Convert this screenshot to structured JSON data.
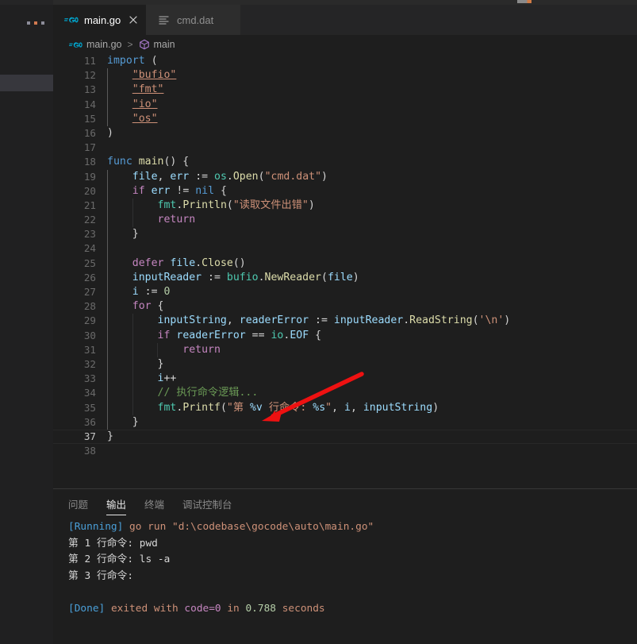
{
  "window": {
    "theme": "dark",
    "colors": {
      "editor_bg": "#1e1e1e",
      "tabbar_bg": "#252526",
      "sidebar_bg": "#202021",
      "accent_keyword": "#569cd6",
      "accent_string": "#ce9178",
      "accent_function": "#dcdcaa",
      "accent_comment": "#6a9955",
      "annotation_arrow": "#ee1111"
    }
  },
  "sidebar": {
    "overflow_label": "...",
    "overflow_icon": "ellipsis-icon"
  },
  "tabs": [
    {
      "label": "main.go",
      "icon": "go-file-icon",
      "active": true,
      "close_icon": "close-icon"
    },
    {
      "label": "cmd.dat",
      "icon": "data-file-icon",
      "active": false
    }
  ],
  "breadcrumb": {
    "items": [
      {
        "label": "main.go",
        "icon": "go-file-icon"
      },
      {
        "label": "main",
        "icon": "symbol-method-cube-icon"
      }
    ],
    "separator": ">"
  },
  "editor": {
    "first_line": 11,
    "active_line": 37,
    "lines": [
      {
        "n": 11,
        "tokens": [
          {
            "t": "import",
            "c": "kw"
          },
          {
            "t": " ",
            "c": "pn"
          },
          {
            "t": "(",
            "c": "pn"
          }
        ]
      },
      {
        "n": 12,
        "tokens": [
          {
            "t": "    ",
            "c": "pn"
          },
          {
            "t": "\"bufio\"",
            "c": "str uline"
          }
        ]
      },
      {
        "n": 13,
        "tokens": [
          {
            "t": "    ",
            "c": "pn"
          },
          {
            "t": "\"fmt\"",
            "c": "str uline"
          }
        ]
      },
      {
        "n": 14,
        "tokens": [
          {
            "t": "    ",
            "c": "pn"
          },
          {
            "t": "\"io\"",
            "c": "str uline"
          }
        ]
      },
      {
        "n": 15,
        "tokens": [
          {
            "t": "    ",
            "c": "pn"
          },
          {
            "t": "\"os\"",
            "c": "str uline"
          }
        ]
      },
      {
        "n": 16,
        "tokens": [
          {
            "t": ")",
            "c": "pn"
          }
        ]
      },
      {
        "n": 17,
        "tokens": []
      },
      {
        "n": 18,
        "tokens": [
          {
            "t": "func ",
            "c": "kw"
          },
          {
            "t": "main",
            "c": "fn"
          },
          {
            "t": "() {",
            "c": "pn"
          }
        ]
      },
      {
        "n": 19,
        "tokens": [
          {
            "t": "    ",
            "c": "pn"
          },
          {
            "t": "file",
            "c": "var"
          },
          {
            "t": ", ",
            "c": "pn"
          },
          {
            "t": "err",
            "c": "var"
          },
          {
            "t": " := ",
            "c": "pn"
          },
          {
            "t": "os",
            "c": "pkg"
          },
          {
            "t": ".",
            "c": "pn"
          },
          {
            "t": "Open",
            "c": "fn"
          },
          {
            "t": "(",
            "c": "pn"
          },
          {
            "t": "\"cmd.dat\"",
            "c": "str"
          },
          {
            "t": ")",
            "c": "pn"
          }
        ]
      },
      {
        "n": 20,
        "tokens": [
          {
            "t": "    ",
            "c": "pn"
          },
          {
            "t": "if",
            "c": "ctl"
          },
          {
            "t": " ",
            "c": "pn"
          },
          {
            "t": "err",
            "c": "var"
          },
          {
            "t": " != ",
            "c": "pn"
          },
          {
            "t": "nil",
            "c": "kw"
          },
          {
            "t": " {",
            "c": "pn"
          }
        ]
      },
      {
        "n": 21,
        "tokens": [
          {
            "t": "        ",
            "c": "pn"
          },
          {
            "t": "fmt",
            "c": "pkg"
          },
          {
            "t": ".",
            "c": "pn"
          },
          {
            "t": "Println",
            "c": "fn"
          },
          {
            "t": "(",
            "c": "pn"
          },
          {
            "t": "\"读取文件出错\"",
            "c": "str"
          },
          {
            "t": ")",
            "c": "pn"
          }
        ]
      },
      {
        "n": 22,
        "tokens": [
          {
            "t": "        ",
            "c": "pn"
          },
          {
            "t": "return",
            "c": "ctl"
          }
        ]
      },
      {
        "n": 23,
        "tokens": [
          {
            "t": "    }",
            "c": "pn"
          }
        ]
      },
      {
        "n": 24,
        "tokens": []
      },
      {
        "n": 25,
        "tokens": [
          {
            "t": "    ",
            "c": "pn"
          },
          {
            "t": "defer",
            "c": "ctl"
          },
          {
            "t": " ",
            "c": "pn"
          },
          {
            "t": "file",
            "c": "var"
          },
          {
            "t": ".",
            "c": "pn"
          },
          {
            "t": "Close",
            "c": "fn"
          },
          {
            "t": "()",
            "c": "pn"
          }
        ]
      },
      {
        "n": 26,
        "tokens": [
          {
            "t": "    ",
            "c": "pn"
          },
          {
            "t": "inputReader",
            "c": "var"
          },
          {
            "t": " := ",
            "c": "pn"
          },
          {
            "t": "bufio",
            "c": "pkg"
          },
          {
            "t": ".",
            "c": "pn"
          },
          {
            "t": "NewReader",
            "c": "fn"
          },
          {
            "t": "(",
            "c": "pn"
          },
          {
            "t": "file",
            "c": "var"
          },
          {
            "t": ")",
            "c": "pn"
          }
        ]
      },
      {
        "n": 27,
        "tokens": [
          {
            "t": "    ",
            "c": "pn"
          },
          {
            "t": "i",
            "c": "var"
          },
          {
            "t": " := ",
            "c": "pn"
          },
          {
            "t": "0",
            "c": "num"
          }
        ]
      },
      {
        "n": 28,
        "tokens": [
          {
            "t": "    ",
            "c": "pn"
          },
          {
            "t": "for",
            "c": "ctl"
          },
          {
            "t": " {",
            "c": "pn"
          }
        ]
      },
      {
        "n": 29,
        "tokens": [
          {
            "t": "        ",
            "c": "pn"
          },
          {
            "t": "inputString",
            "c": "var"
          },
          {
            "t": ", ",
            "c": "pn"
          },
          {
            "t": "readerError",
            "c": "var"
          },
          {
            "t": " := ",
            "c": "pn"
          },
          {
            "t": "inputReader",
            "c": "var"
          },
          {
            "t": ".",
            "c": "pn"
          },
          {
            "t": "ReadString",
            "c": "fn"
          },
          {
            "t": "(",
            "c": "pn"
          },
          {
            "t": "'\\n'",
            "c": "str"
          },
          {
            "t": ")",
            "c": "pn"
          }
        ]
      },
      {
        "n": 30,
        "tokens": [
          {
            "t": "        ",
            "c": "pn"
          },
          {
            "t": "if",
            "c": "ctl"
          },
          {
            "t": " ",
            "c": "pn"
          },
          {
            "t": "readerError",
            "c": "var"
          },
          {
            "t": " == ",
            "c": "pn"
          },
          {
            "t": "io",
            "c": "pkg"
          },
          {
            "t": ".",
            "c": "pn"
          },
          {
            "t": "EOF",
            "c": "var"
          },
          {
            "t": " {",
            "c": "pn"
          }
        ]
      },
      {
        "n": 31,
        "tokens": [
          {
            "t": "            ",
            "c": "pn"
          },
          {
            "t": "return",
            "c": "ctl"
          }
        ]
      },
      {
        "n": 32,
        "tokens": [
          {
            "t": "        }",
            "c": "pn"
          }
        ]
      },
      {
        "n": 33,
        "tokens": [
          {
            "t": "        ",
            "c": "pn"
          },
          {
            "t": "i",
            "c": "var"
          },
          {
            "t": "++",
            "c": "pn"
          }
        ]
      },
      {
        "n": 34,
        "tokens": [
          {
            "t": "        ",
            "c": "pn"
          },
          {
            "t": "// 执行命令逻辑...",
            "c": "cm"
          }
        ]
      },
      {
        "n": 35,
        "tokens": [
          {
            "t": "        ",
            "c": "pn"
          },
          {
            "t": "fmt",
            "c": "pkg"
          },
          {
            "t": ".",
            "c": "pn"
          },
          {
            "t": "Printf",
            "c": "fn"
          },
          {
            "t": "(",
            "c": "pn"
          },
          {
            "t": "\"第 ",
            "c": "str"
          },
          {
            "t": "%v",
            "c": "var"
          },
          {
            "t": " 行命令: ",
            "c": "str"
          },
          {
            "t": "%s",
            "c": "var"
          },
          {
            "t": "\"",
            "c": "str"
          },
          {
            "t": ", ",
            "c": "pn"
          },
          {
            "t": "i",
            "c": "var"
          },
          {
            "t": ", ",
            "c": "pn"
          },
          {
            "t": "inputString",
            "c": "var"
          },
          {
            "t": ")",
            "c": "pn"
          }
        ]
      },
      {
        "n": 36,
        "tokens": [
          {
            "t": "    }",
            "c": "pn"
          }
        ]
      },
      {
        "n": 37,
        "tokens": [
          {
            "t": "}",
            "c": "pn"
          }
        ]
      },
      {
        "n": 38,
        "tokens": []
      }
    ]
  },
  "panel": {
    "tabs": [
      {
        "label": "问题",
        "active": false
      },
      {
        "label": "输出",
        "active": true
      },
      {
        "label": "终端",
        "active": false
      },
      {
        "label": "调试控制台",
        "active": false
      }
    ],
    "output_lines": [
      {
        "segs": [
          {
            "t": "[Running]",
            "c": "o-blue"
          },
          {
            "t": " go run ",
            "c": "o-orange"
          },
          {
            "t": "\"d:\\codebase\\gocode\\auto\\main.go\"",
            "c": "o-orange"
          }
        ]
      },
      {
        "segs": [
          {
            "t": "第 ",
            "c": "o-white"
          },
          {
            "t": "1",
            "c": "o-white"
          },
          {
            "t": " 行命令: ",
            "c": "o-white"
          },
          {
            "t": "pwd",
            "c": "o-white"
          }
        ]
      },
      {
        "segs": [
          {
            "t": "第 ",
            "c": "o-white"
          },
          {
            "t": "2",
            "c": "o-white"
          },
          {
            "t": " 行命令: ",
            "c": "o-white"
          },
          {
            "t": "ls -a",
            "c": "o-white"
          }
        ]
      },
      {
        "segs": [
          {
            "t": "第 ",
            "c": "o-white"
          },
          {
            "t": "3",
            "c": "o-white"
          },
          {
            "t": " 行命令: ",
            "c": "o-white"
          }
        ]
      },
      {
        "segs": []
      },
      {
        "segs": [
          {
            "t": "[Done]",
            "c": "o-blue"
          },
          {
            "t": " exited with ",
            "c": "o-orange"
          },
          {
            "t": "code=0",
            "c": "o-mag"
          },
          {
            "t": " in ",
            "c": "o-orange"
          },
          {
            "t": "0.788",
            "c": "o-num"
          },
          {
            "t": " seconds",
            "c": "o-orange"
          }
        ]
      }
    ]
  },
  "annotation": {
    "type": "arrow",
    "color": "#ee1111",
    "points_to_line": 34,
    "description": "red arrow pointing at the 执行命令逻辑 comment line"
  }
}
